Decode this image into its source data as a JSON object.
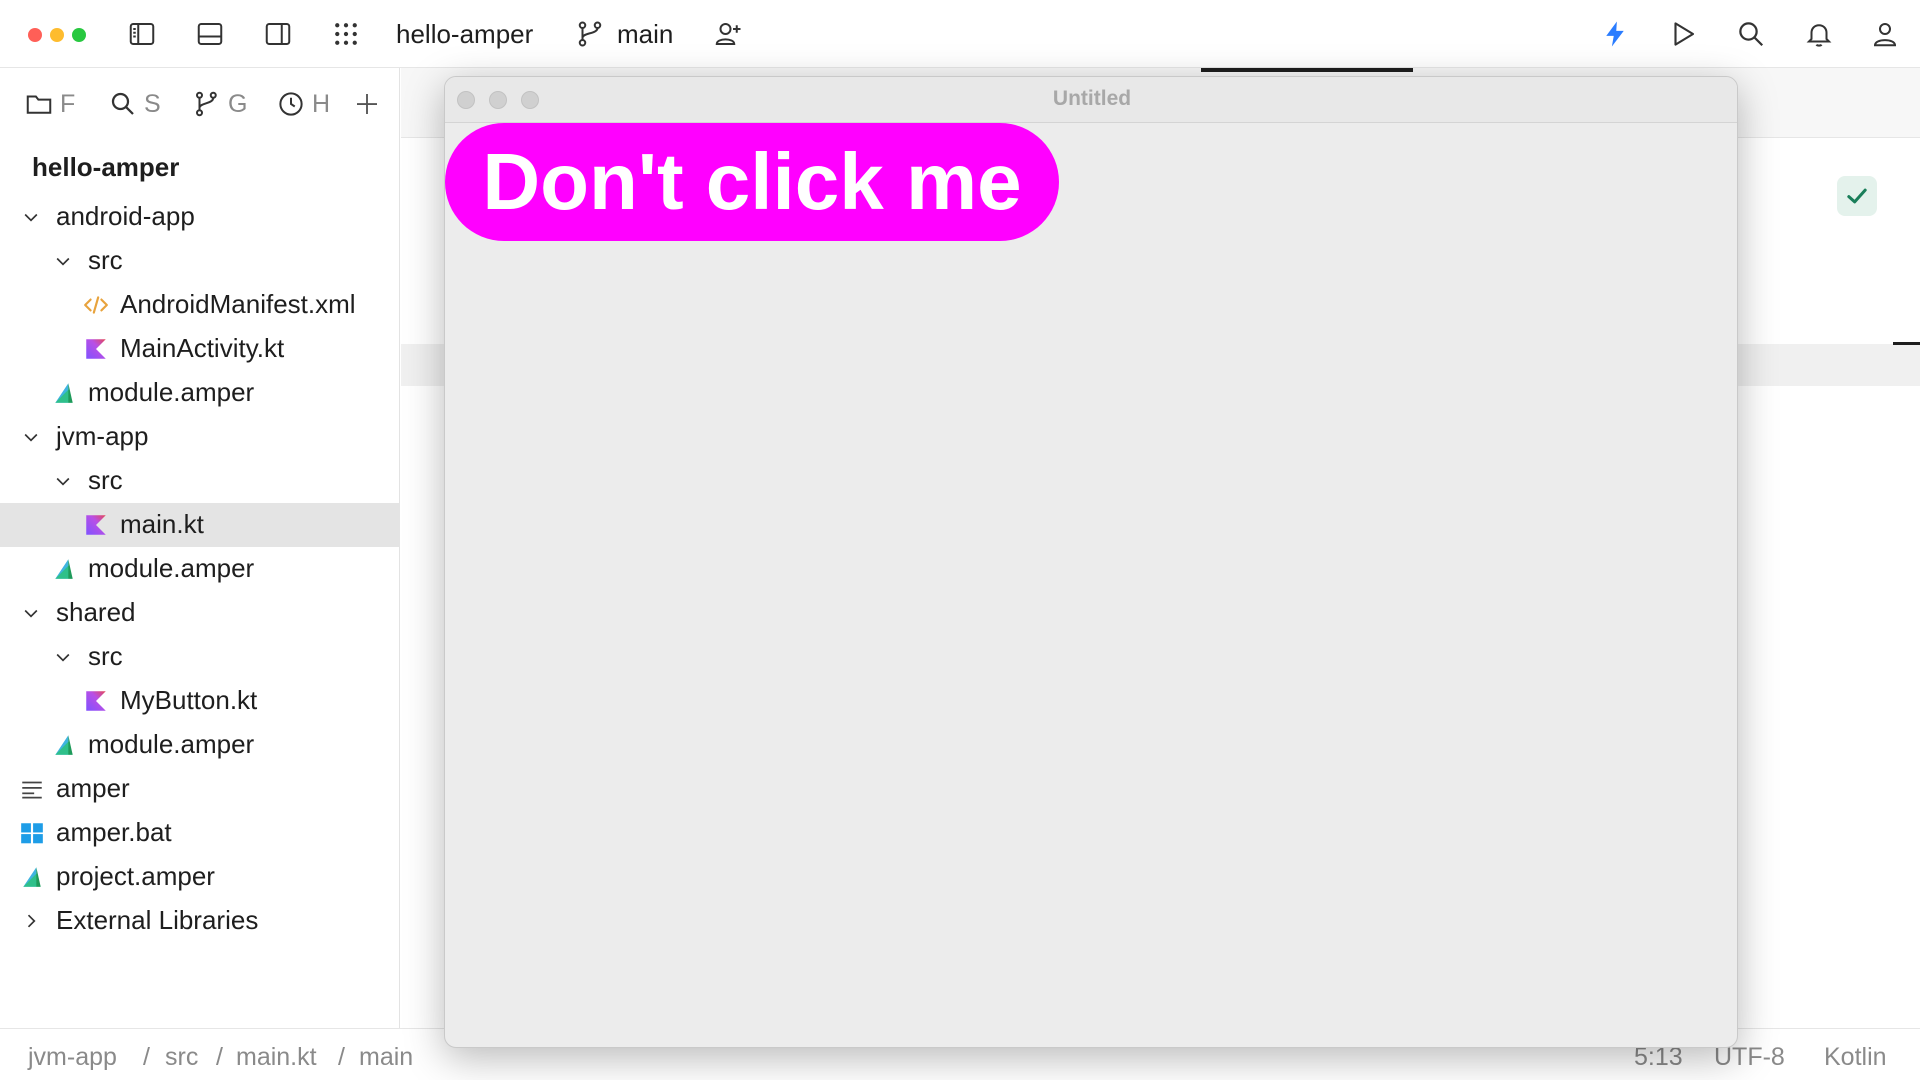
{
  "titlebar": {
    "project_name": "hello-amper",
    "branch": "main",
    "traffic_colors": [
      "#ff5f57",
      "#febc2e",
      "#28c840"
    ],
    "accent": "#2a7cff",
    "icons": [
      "sidebar-left-icon",
      "panel-bottom-icon",
      "sidebar-right-icon",
      "apps-grid-icon",
      "branch-icon",
      "add-user-icon",
      "lightning-icon",
      "run-icon",
      "search-icon",
      "bell-icon",
      "profile-icon"
    ]
  },
  "side_tabs": [
    {
      "label": "F",
      "icon": "folder-icon"
    },
    {
      "label": "S",
      "icon": "search-icon"
    },
    {
      "label": "G",
      "icon": "git-branch-icon"
    },
    {
      "label": "H",
      "icon": "history-icon"
    }
  ],
  "sidebar": {
    "project_title": "hello-amper",
    "tree": [
      {
        "label": "android-app",
        "icon": "none",
        "expanded": true
      },
      {
        "label": "src",
        "icon": "none",
        "expanded": true
      },
      {
        "label": "AndroidManifest.xml",
        "icon": "xml-icon"
      },
      {
        "label": "MainActivity.kt",
        "icon": "kotlin-icon"
      },
      {
        "label": "module.amper",
        "icon": "amper-icon"
      },
      {
        "label": "jvm-app",
        "icon": "none",
        "expanded": true
      },
      {
        "label": "src",
        "icon": "none",
        "expanded": true
      },
      {
        "label": "main.kt",
        "icon": "kotlin-icon",
        "selected": true
      },
      {
        "label": "module.amper",
        "icon": "amper-icon"
      },
      {
        "label": "shared",
        "icon": "none",
        "expanded": true
      },
      {
        "label": "src",
        "icon": "none",
        "expanded": true
      },
      {
        "label": "MyButton.kt",
        "icon": "kotlin-icon"
      },
      {
        "label": "module.amper",
        "icon": "amper-icon"
      },
      {
        "label": "amper",
        "icon": "text-file-icon"
      },
      {
        "label": "amper.bat",
        "icon": "windows-icon"
      },
      {
        "label": "project.amper",
        "icon": "amper-icon"
      },
      {
        "label": "External Libraries",
        "icon": "none",
        "expanded": false
      }
    ]
  },
  "app_window": {
    "title": "Untitled",
    "button_label": "Don't click me",
    "button_color": "#ff00ff"
  },
  "statusbar": {
    "breadcrumb": [
      "jvm-app",
      "src",
      "main.kt",
      "main"
    ],
    "separator": "/",
    "position": "5:13",
    "encoding": "UTF-8",
    "language": "Kotlin"
  }
}
